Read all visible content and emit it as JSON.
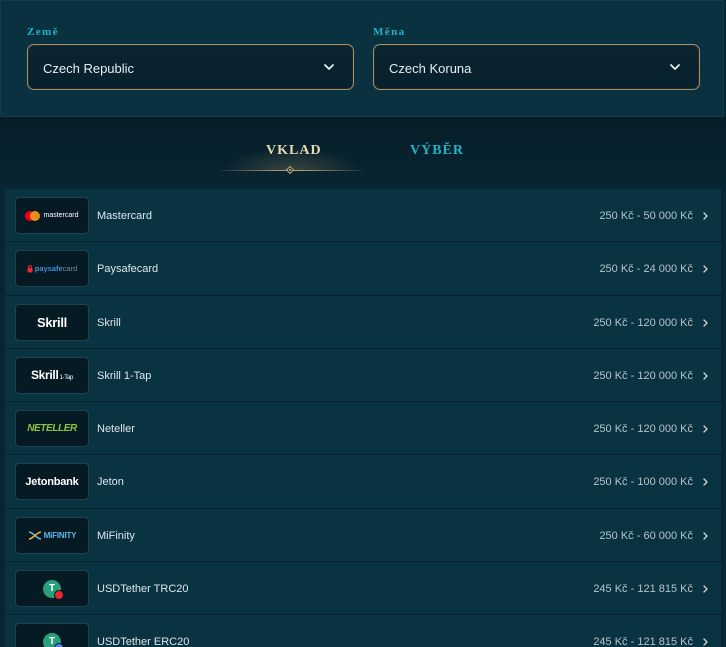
{
  "filters": {
    "country": {
      "label": "Země",
      "value": "Czech Republic"
    },
    "currency": {
      "label": "Měna",
      "value": "Czech Koruna"
    }
  },
  "tabs": {
    "deposit": "VKLAD",
    "withdraw": "VÝBĚR",
    "active": "deposit"
  },
  "colors": {
    "accent_gold": "#c8aa6e",
    "accent_teal": "#1fb3c7",
    "row_background": "#0a3342"
  },
  "methods": [
    {
      "name": "Mastercard",
      "range": "250 Kč - 50 000 Kč",
      "logo_text": "mastercard",
      "logo_icon": "mastercard-circles-icon"
    },
    {
      "name": "Paysafecard",
      "range": "250 Kč - 24 000 Kč",
      "logo_text_main": "paysafe",
      "logo_text_sub": "card",
      "logo_icon": "paysafecard-lock-icon"
    },
    {
      "name": "Skrill",
      "range": "250 Kč - 120 000 Kč",
      "logo_text": "Skrill"
    },
    {
      "name": "Skrill 1-Tap",
      "range": "250 Kč - 120 000 Kč",
      "logo_text": "Skrill",
      "logo_text_sub": "1-Tap"
    },
    {
      "name": "Neteller",
      "range": "250 Kč - 120 000 Kč",
      "logo_text": "NETELLER"
    },
    {
      "name": "Jeton",
      "range": "250 Kč - 100 000 Kč",
      "logo_text": "Jetonbank"
    },
    {
      "name": "MiFinity",
      "range": "250 Kč - 60 000 Kč",
      "logo_text": "MiFINITY",
      "logo_icon": "mifinity-x-icon"
    },
    {
      "name": "USDTether TRC20",
      "range": "245 Kč - 121 815 Kč",
      "logo_icon": "tether-icon",
      "logo_badge_color": "#e8272e"
    },
    {
      "name": "USDTether ERC20",
      "range": "245 Kč - 121 815 Kč",
      "logo_icon": "tether-icon",
      "logo_badge_color": "#627eea"
    }
  ]
}
